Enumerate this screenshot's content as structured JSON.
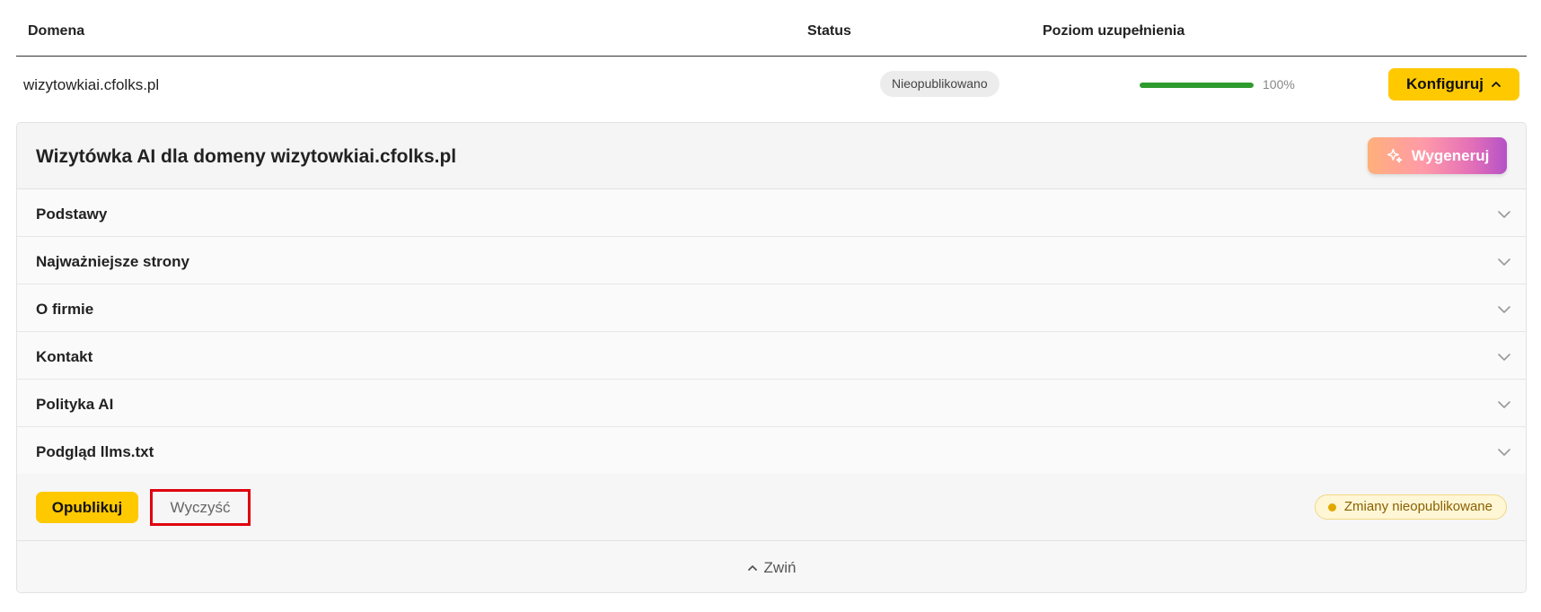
{
  "table": {
    "headers": {
      "domain": "Domena",
      "status": "Status",
      "completion": "Poziom uzupełnienia"
    },
    "row": {
      "domain": "wizytowkiai.cfolks.pl",
      "status": "Nieopublikowano",
      "progress_percent": 100,
      "progress_label": "100%",
      "configure_label": "Konfiguruj",
      "configure_icon": "chevron-up-icon"
    }
  },
  "panel": {
    "title": "Wizytówka AI dla domeny wizytowkiai.cfolks.pl",
    "generate_label": "Wygeneruj",
    "generate_icon": "sparkles-icon",
    "sections": [
      {
        "label": "Podstawy"
      },
      {
        "label": "Najważniejsze strony"
      },
      {
        "label": "O firmie"
      },
      {
        "label": "Kontakt"
      },
      {
        "label": "Polityka AI"
      },
      {
        "label": "Podgląd llms.txt"
      }
    ],
    "publish_label": "Opublikuj",
    "clear_label": "Wyczyść",
    "unpublished_badge": "Zmiany nieopublikowane",
    "collapse_label": "Zwiń"
  },
  "colors": {
    "accent_yellow": "#ffc900",
    "progress_green": "#2e9b2e",
    "highlight_red": "#e0000f",
    "badge_amber": "#e0a800"
  }
}
